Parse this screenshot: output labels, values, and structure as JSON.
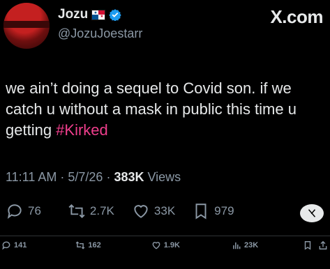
{
  "author": {
    "name": "Jozu",
    "flag_icon": "panama-flag-icon",
    "verified_icon": "verified-badge-icon",
    "handle": "@JozuJoestarr",
    "avatar_icon": "avatar-image"
  },
  "brand": {
    "label": "X.com"
  },
  "tweet": {
    "text": "we ain’t doing a sequel to Covid son. if we catch u without a mask in public this time u getting ",
    "hashtag": "#Kirked"
  },
  "meta": {
    "time": "11:11 AM",
    "sep1": "·",
    "date": "5/7/26",
    "sep2": "·",
    "views_count": "383K",
    "views_label": "Views"
  },
  "actions": {
    "replies": "76",
    "reposts": "2.7K",
    "likes": "33K",
    "bookmarks": "979"
  },
  "bottom_bar": {
    "replies": "141",
    "reposts": "162",
    "likes": "1.9K",
    "views": "23K"
  },
  "colors": {
    "background": "#000000",
    "text": "#e7e9ea",
    "muted": "#8b98a5",
    "hashtag": "#ef3e8c",
    "verified": "#1d9bf0"
  }
}
